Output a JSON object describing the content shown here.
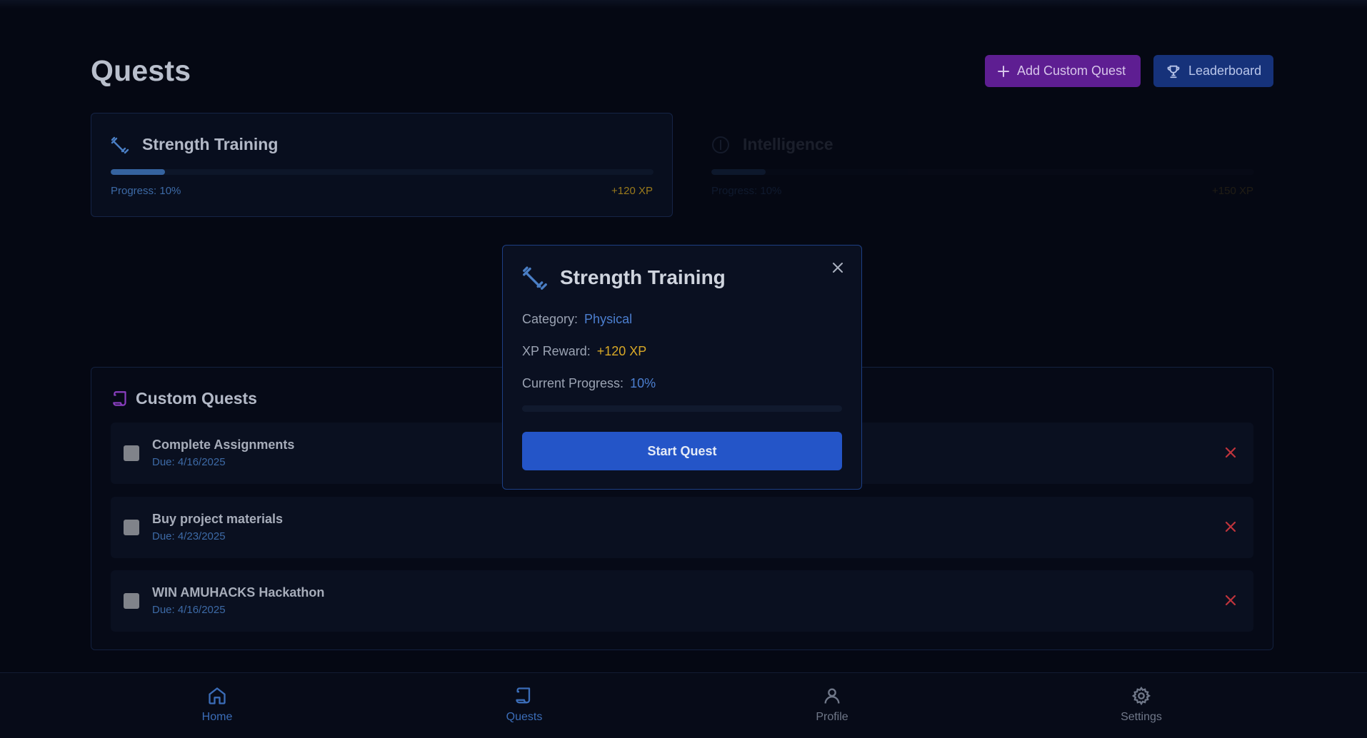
{
  "page": {
    "title": "Quests"
  },
  "toolbar": {
    "add_label": "Add Custom Quest",
    "leaderboard_label": "Leaderboard"
  },
  "quests": [
    {
      "name": "Strength Training",
      "progress_text": "Progress: 10%",
      "progress": 0.1,
      "xp": "+120 XP",
      "icon": "dumbbell-icon"
    },
    {
      "name": "Intelligence",
      "progress_text": "Progress: 10%",
      "progress": 0.1,
      "xp": "+150 XP",
      "icon": "brain-icon"
    }
  ],
  "custom": {
    "title": "Custom Quests",
    "items": [
      {
        "name": "Complete Assignments",
        "due": "Due: 4/16/2025"
      },
      {
        "name": "Buy project materials",
        "due": "Due: 4/23/2025"
      },
      {
        "name": "WIN AMUHACKS Hackathon",
        "due": "Due: 4/16/2025"
      }
    ]
  },
  "modal": {
    "title": "Strength Training",
    "category_label": "Category:",
    "category_value": "Physical",
    "xp_label": "XP Reward:",
    "xp_value": "+120 XP",
    "progress_label": "Current Progress:",
    "progress_value": "10%",
    "progress": 0.1,
    "start_label": "Start Quest"
  },
  "nav": [
    {
      "label": "Home",
      "icon": "home-icon",
      "active": false
    },
    {
      "label": "Quests",
      "icon": "scroll-icon",
      "active": true
    },
    {
      "label": "Profile",
      "icon": "user-icon",
      "active": false
    },
    {
      "label": "Settings",
      "icon": "gear-icon",
      "active": false
    }
  ],
  "colors": {
    "accent_blue": "#2455c8",
    "accent_purple": "#5e1e92",
    "xp_gold": "#d8a827",
    "delete_red": "#c0343c"
  }
}
